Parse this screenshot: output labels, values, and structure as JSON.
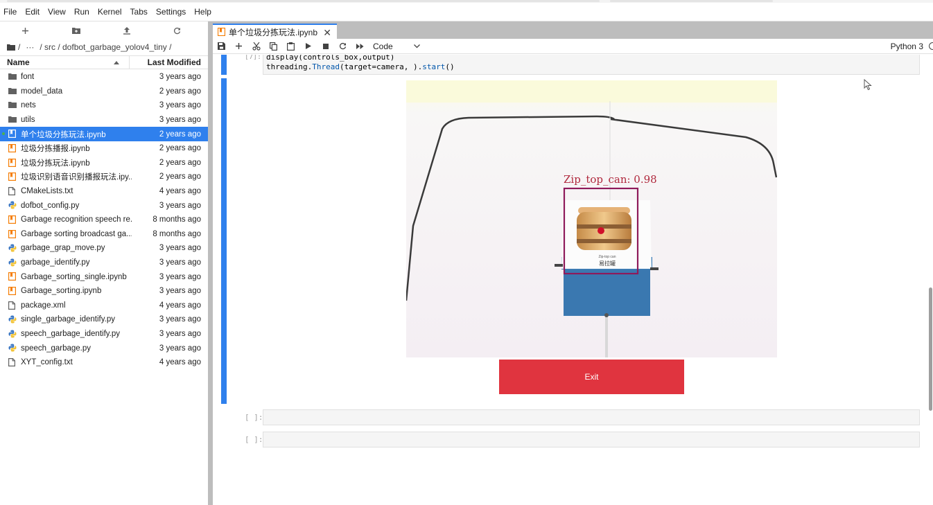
{
  "menu": [
    "File",
    "Edit",
    "View",
    "Run",
    "Kernel",
    "Tabs",
    "Settings",
    "Help"
  ],
  "breadcrumbs": {
    "root": "/",
    "ellipsis": "···",
    "path": "/ src / dofbot_garbage_yolov4_tiny /"
  },
  "file_browser": {
    "col_name": "Name",
    "col_modified": "Last Modified",
    "files": [
      {
        "name": "font",
        "modified": "3 years ago",
        "type": "folder"
      },
      {
        "name": "model_data",
        "modified": "2 years ago",
        "type": "folder"
      },
      {
        "name": "nets",
        "modified": "3 years ago",
        "type": "folder"
      },
      {
        "name": "utils",
        "modified": "3 years ago",
        "type": "folder"
      },
      {
        "name": "单个垃圾分拣玩法.ipynb",
        "modified": "2 years ago",
        "type": "notebook",
        "selected": true
      },
      {
        "name": "垃圾分拣播报.ipynb",
        "modified": "2 years ago",
        "type": "notebook"
      },
      {
        "name": "垃圾分拣玩法.ipynb",
        "modified": "2 years ago",
        "type": "notebook"
      },
      {
        "name": "垃圾识别语音识别播报玩法.ipy...",
        "modified": "2 years ago",
        "type": "notebook"
      },
      {
        "name": "CMakeLists.txt",
        "modified": "4 years ago",
        "type": "file"
      },
      {
        "name": "dofbot_config.py",
        "modified": "3 years ago",
        "type": "python"
      },
      {
        "name": "Garbage recognition speech re...",
        "modified": "8 months ago",
        "type": "notebook"
      },
      {
        "name": "Garbage sorting broadcast ga...",
        "modified": "8 months ago",
        "type": "notebook"
      },
      {
        "name": "garbage_grap_move.py",
        "modified": "3 years ago",
        "type": "python"
      },
      {
        "name": "garbage_identify.py",
        "modified": "3 years ago",
        "type": "python"
      },
      {
        "name": "Garbage_sorting_single.ipynb",
        "modified": "3 years ago",
        "type": "notebook"
      },
      {
        "name": "Garbage_sorting.ipynb",
        "modified": "3 years ago",
        "type": "notebook"
      },
      {
        "name": "package.xml",
        "modified": "4 years ago",
        "type": "file"
      },
      {
        "name": "single_garbage_identify.py",
        "modified": "3 years ago",
        "type": "python"
      },
      {
        "name": "speech_garbage_identify.py",
        "modified": "3 years ago",
        "type": "python"
      },
      {
        "name": "speech_garbage.py",
        "modified": "3 years ago",
        "type": "python"
      },
      {
        "name": "XYT_config.txt",
        "modified": "4 years ago",
        "type": "file"
      }
    ]
  },
  "tab": {
    "title": "单个垃圾分拣玩法.ipynb"
  },
  "toolbar": {
    "cell_type": "Code",
    "kernel": "Python 3"
  },
  "code": {
    "prompt": "[7]:",
    "line1": "display(controls_box,output)",
    "line2_prefix": "threading.",
    "line2_fn": "Thread",
    "line2_mid": "(target=camera, ).",
    "line2_fn2": "start",
    "line2_end": "()"
  },
  "output": {
    "detection_label": "Zip_top_can: 0.98",
    "box_caption": "易拉罐",
    "box_caption_en": "Zip-top can",
    "exit_label": "Exit"
  },
  "empty_cells": [
    {
      "prompt": "[ ]:"
    },
    {
      "prompt": "[ ]:"
    }
  ],
  "colors": {
    "accent": "#2f80ed",
    "exit": "#e0343f",
    "detect": "#b0283c",
    "notebook_icon": "#f57c00",
    "python_icon": "#3e79c4"
  }
}
